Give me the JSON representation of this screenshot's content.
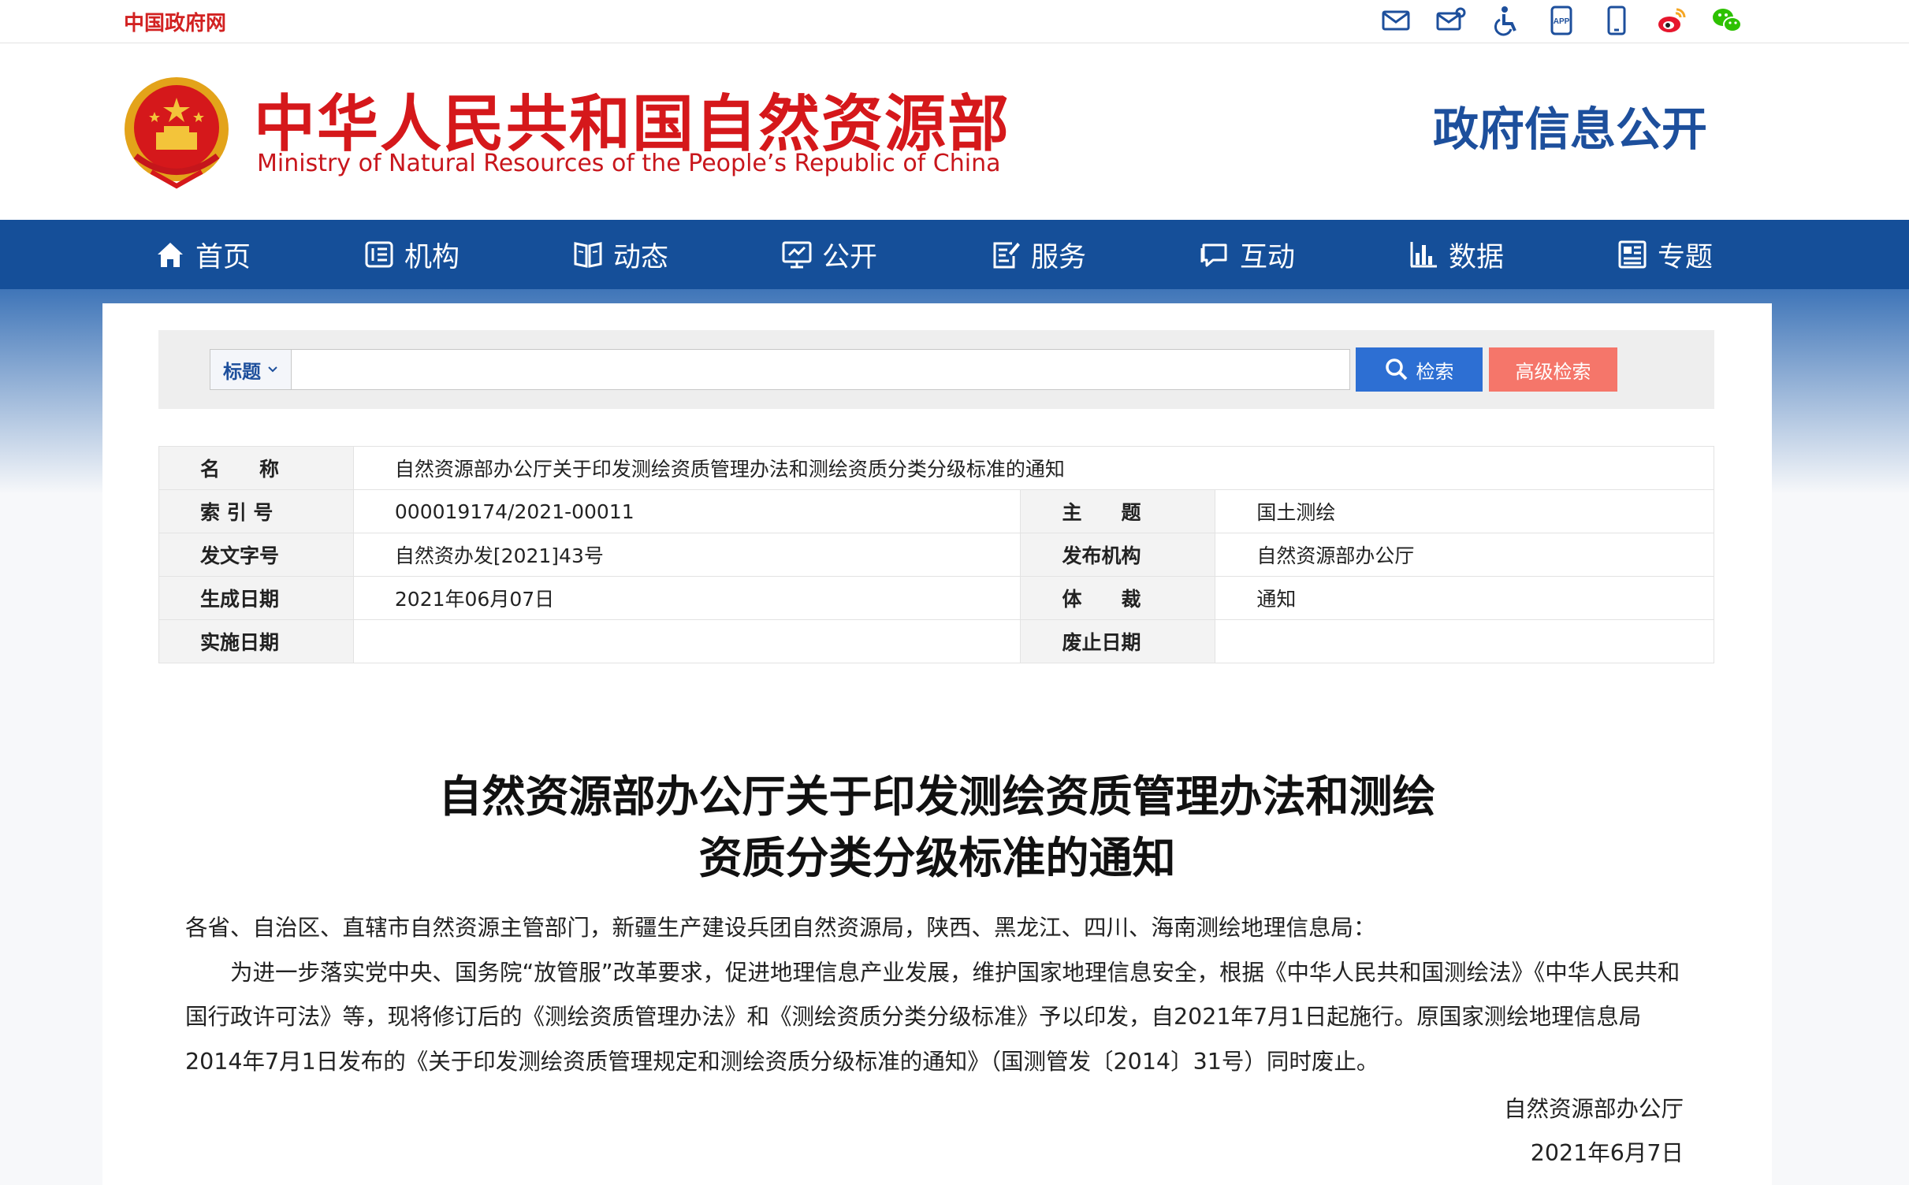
{
  "topbar": {
    "gov_link": "中国政府网",
    "icons": [
      "mail-icon",
      "mail-settings-icon",
      "accessibility-icon",
      "app-icon",
      "mobile-icon",
      "weibo-icon",
      "wechat-icon"
    ]
  },
  "header": {
    "title": "中华人民共和国自然资源部",
    "subtitle": "Ministry of Natural Resources of the People’s Republic of China",
    "section": "政府信息公开"
  },
  "nav": {
    "items": [
      {
        "label": "首页",
        "icon": "home-icon"
      },
      {
        "label": "机构",
        "icon": "org-icon"
      },
      {
        "label": "动态",
        "icon": "book-icon"
      },
      {
        "label": "公开",
        "icon": "monitor-icon"
      },
      {
        "label": "服务",
        "icon": "edit-doc-icon"
      },
      {
        "label": "互动",
        "icon": "chat-icon"
      },
      {
        "label": "数据",
        "icon": "bar-chart-icon"
      },
      {
        "label": "专题",
        "icon": "topic-icon"
      }
    ]
  },
  "search": {
    "scope": "标题",
    "placeholder": "",
    "search_label": "检索",
    "advanced_label": "高级检索"
  },
  "meta": {
    "name_label": "名　　称",
    "name_value": "自然资源部办公厅关于印发测绘资质管理办法和测绘资质分类分级标准的通知",
    "index_label": "索 引 号",
    "index_value": "000019174/2021-00011",
    "topic_label": "主　　题",
    "topic_value": "国土测绘",
    "docno_label": "发文字号",
    "docno_value": "自然资办发[2021]43号",
    "org_label": "发布机构",
    "org_value": "自然资源部办公厅",
    "created_label": "生成日期",
    "created_value": "2021年06月07日",
    "genre_label": "体　　裁",
    "genre_value": "通知",
    "effective_label": "实施日期",
    "effective_value": "",
    "abolish_label": "废止日期",
    "abolish_value": ""
  },
  "doc": {
    "title_line1": "自然资源部办公厅关于印发测绘资质管理办法和测绘",
    "title_line2": "资质分类分级标准的通知",
    "addressee": "各省、自治区、直辖市自然资源主管部门，新疆生产建设兵团自然资源局，陕西、黑龙江、四川、海南测绘地理信息局：",
    "paragraph": "为进一步落实党中央、国务院“放管服”改革要求，促进地理信息产业发展，维护国家地理信息安全，根据《中华人民共和国测绘法》《中华人民共和国行政许可法》等，现将修订后的《测绘资质管理办法》和《测绘资质分类分级标准》予以印发，自2021年7月1日起施行。原国家测绘地理信息局2014年7月1日发布的《关于印发测绘资质管理规定和测绘资质分级标准的通知》（国测管发〔2014〕31号）同时废止。",
    "signature": "自然资源部办公厅",
    "date": "2021年6月7日"
  },
  "colors": {
    "brand_red": "#d5181b",
    "nav_blue": "#154f99",
    "search_blue": "#2d6fd3",
    "advanced_red": "#f5766a"
  }
}
